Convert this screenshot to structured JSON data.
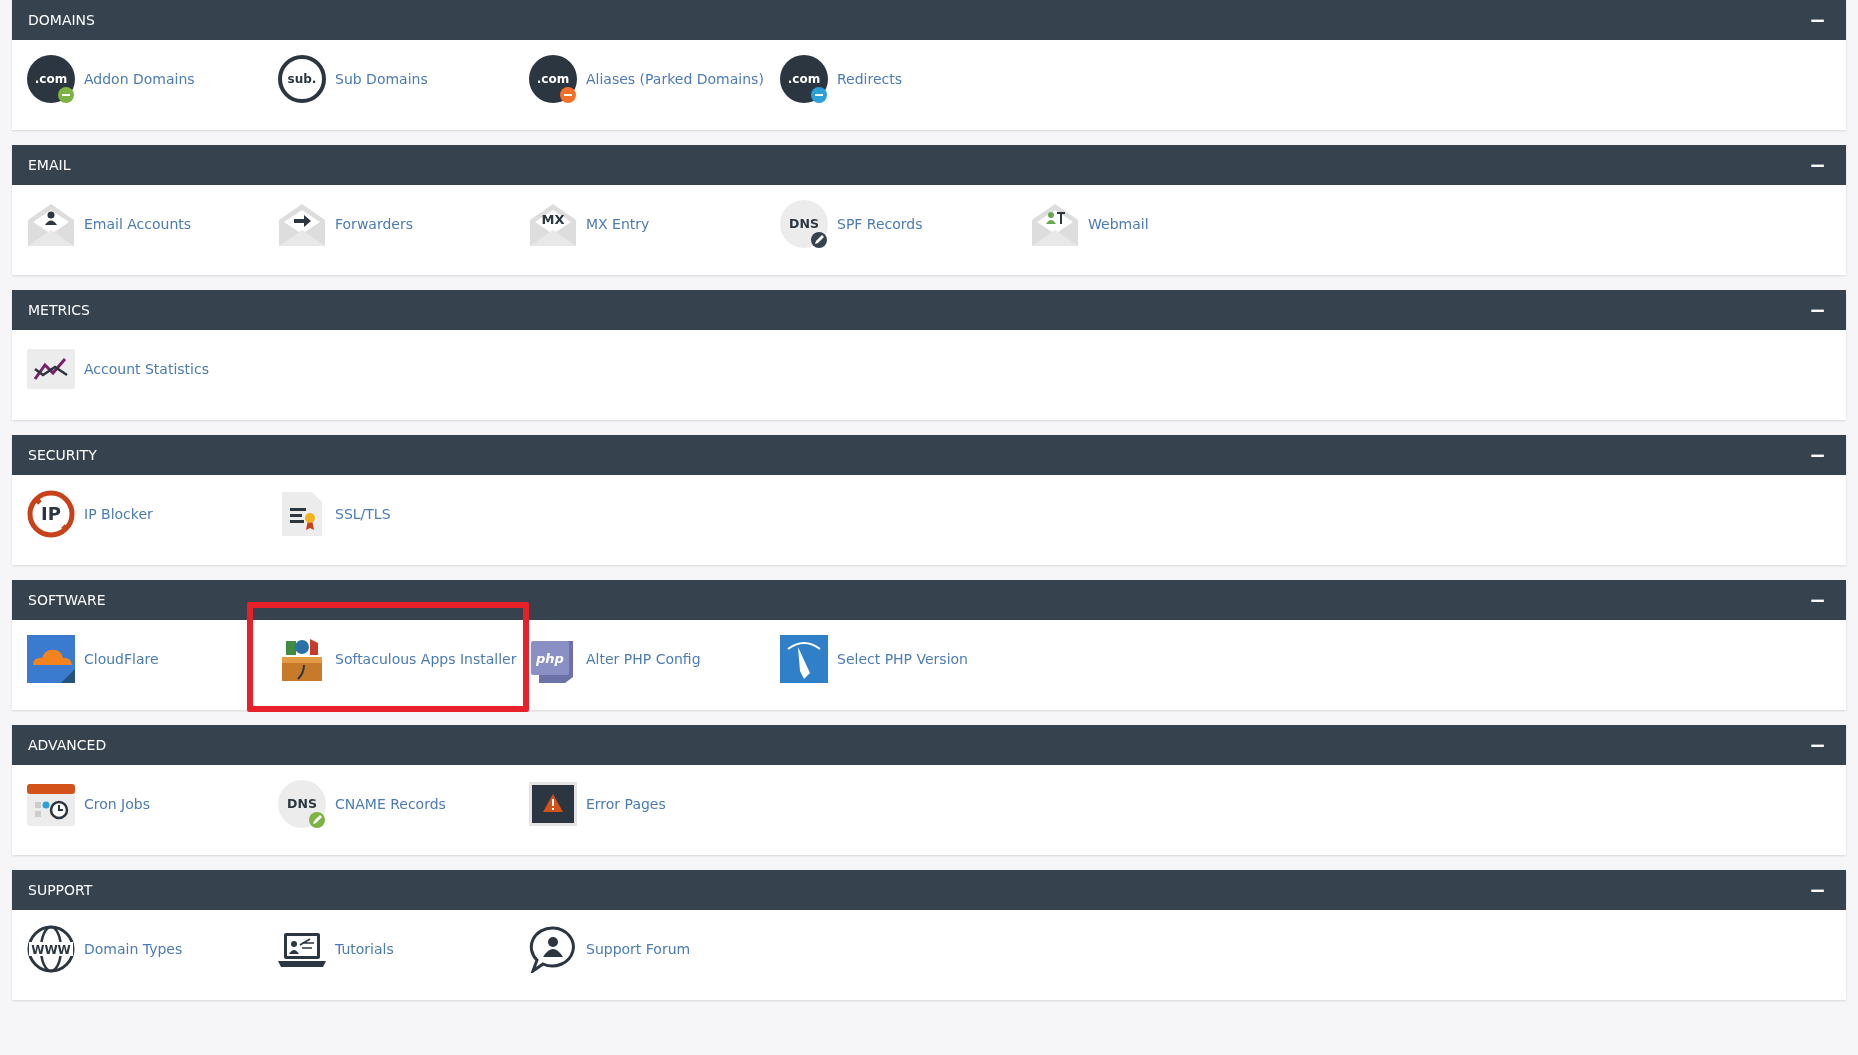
{
  "sections": [
    {
      "title": "DOMAINS",
      "collapse": "−",
      "items": [
        {
          "label": "Addon Domains",
          "kind": "domain",
          "icon_text": ".com",
          "color": "#7cb342",
          "highlighted": false
        },
        {
          "label": "Sub Domains",
          "kind": "ring",
          "icon_text": "sub.",
          "highlighted": false
        },
        {
          "label": "Aliases (Parked Domains)",
          "kind": "domain",
          "icon_text": ".com",
          "color": "#f4702a",
          "highlighted": false
        },
        {
          "label": "Redirects",
          "kind": "domain",
          "icon_text": ".com",
          "color": "#2a9fd8",
          "highlighted": false
        }
      ]
    },
    {
      "title": "EMAIL",
      "collapse": "−",
      "items": [
        {
          "label": "Email Accounts",
          "kind": "account",
          "highlighted": false
        },
        {
          "label": "Forwarders",
          "kind": "forward",
          "highlighted": false
        },
        {
          "label": "MX Entry",
          "kind": "mail",
          "icon_text": "MX",
          "highlighted": false
        },
        {
          "label": "SPF Records",
          "kind": "dns",
          "icon_text": "DNS",
          "color": "#36434f",
          "highlighted": false
        },
        {
          "label": "Webmail",
          "kind": "webmail",
          "highlighted": false
        }
      ]
    },
    {
      "title": "METRICS",
      "collapse": "−",
      "items": [
        {
          "label": "Account Statistics",
          "kind": "chart",
          "highlighted": false
        }
      ]
    },
    {
      "title": "SECURITY",
      "collapse": "−",
      "items": [
        {
          "label": "IP Blocker",
          "kind": "block",
          "icon_text": "IP",
          "highlighted": false
        },
        {
          "label": "SSL/TLS",
          "kind": "certificate",
          "highlighted": false
        }
      ]
    },
    {
      "title": "SOFTWARE",
      "collapse": "−",
      "items": [
        {
          "label": "CloudFlare",
          "kind": "cloud",
          "highlighted": false
        },
        {
          "label": "Softaculous Apps Installer",
          "kind": "toolbox",
          "highlighted": true
        },
        {
          "label": "Alter PHP Config",
          "kind": "php",
          "icon_text": "php",
          "highlighted": false
        },
        {
          "label": "Select PHP Version",
          "kind": "gauge",
          "highlighted": false
        }
      ]
    },
    {
      "title": "ADVANCED",
      "collapse": "−",
      "items": [
        {
          "label": "Cron Jobs",
          "kind": "calendar",
          "highlighted": false
        },
        {
          "label": "CNAME Records",
          "kind": "dns",
          "icon_text": "DNS",
          "color": "#7cb342",
          "highlighted": false
        },
        {
          "label": "Error Pages",
          "kind": "error",
          "highlighted": false
        }
      ]
    },
    {
      "title": "SUPPORT",
      "collapse": "−",
      "items": [
        {
          "label": "Domain Types",
          "kind": "globe",
          "icon_text": "WWW",
          "highlighted": false
        },
        {
          "label": "Tutorials",
          "kind": "laptop",
          "highlighted": false
        },
        {
          "label": "Support Forum",
          "kind": "speech",
          "highlighted": false
        }
      ]
    }
  ]
}
